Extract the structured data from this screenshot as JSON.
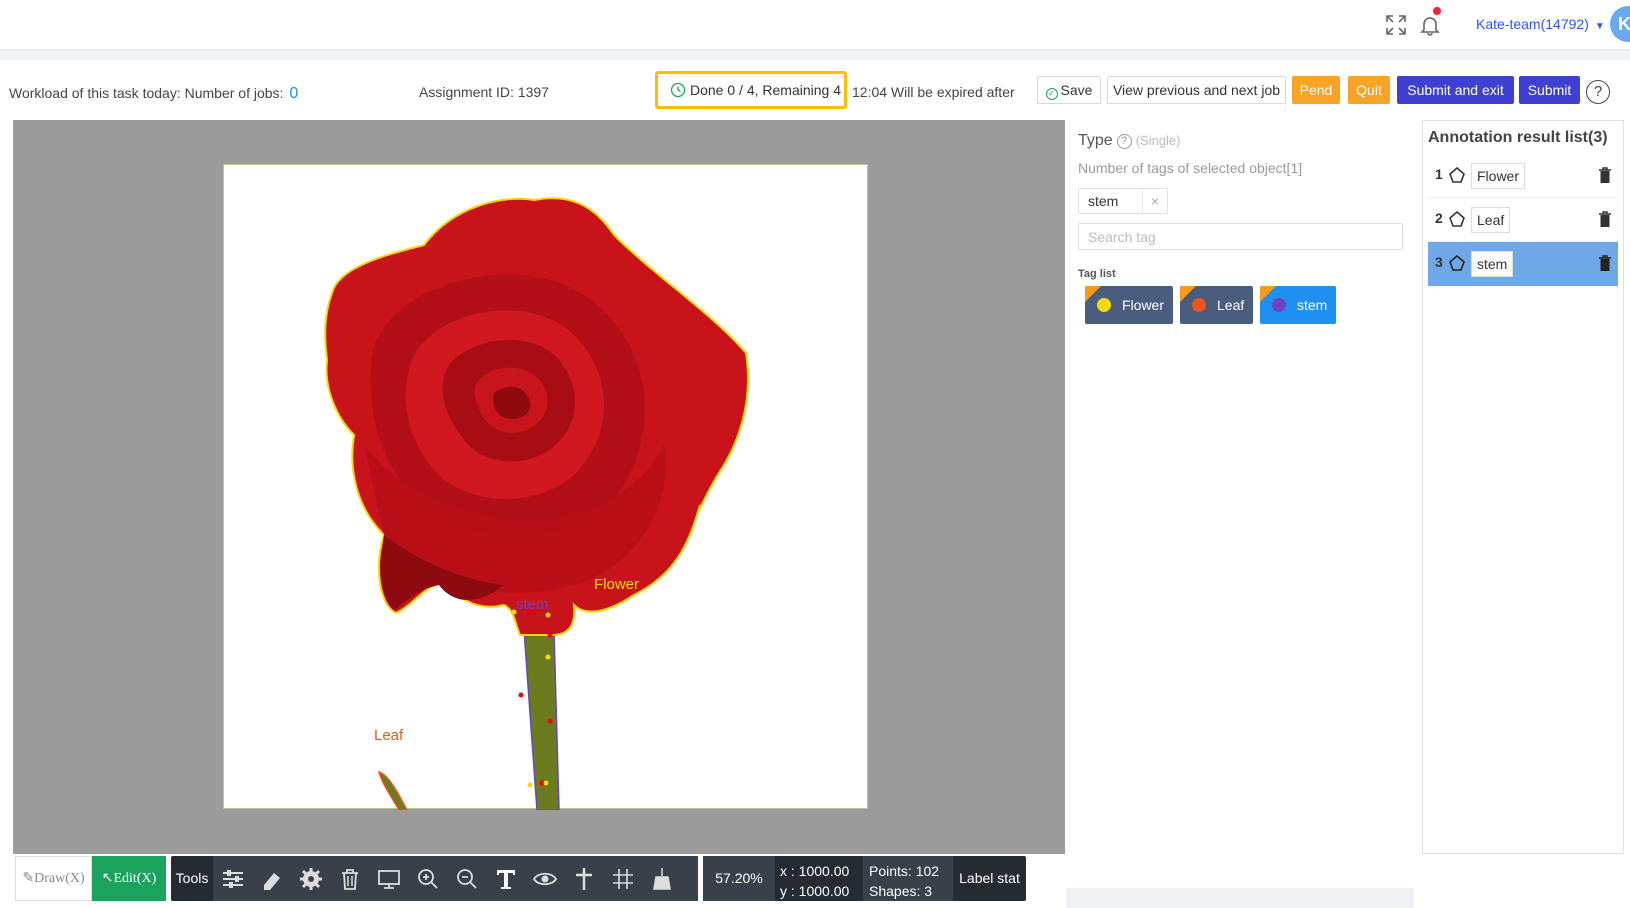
{
  "header": {
    "user": "Kate-team(14792)",
    "avatar_letter": "K"
  },
  "task": {
    "workload_label": "Workload of this task today: Number of jobs:",
    "workload_count": "0",
    "assignment": "Assignment ID: 1397",
    "progress": "Done 0 / 4, Remaining 4",
    "expire": "12:04 Will be expired after",
    "buttons": {
      "save": "Save",
      "view": "View previous and next job",
      "pend": "Pend",
      "quit": "Quit",
      "submit_exit": "Submit and exit",
      "submit": "Submit"
    },
    "help": "?"
  },
  "canvas": {
    "labels": {
      "flower": "Flower",
      "stem": "stem",
      "leaf": "Leaf"
    }
  },
  "toolbar": {
    "draw": "Draw(X)",
    "edit": "Edit(X)",
    "tools": "Tools",
    "zoom": "57.20%",
    "x": "x : 1000.00",
    "y": "y : 1000.00",
    "points": "Points:  102",
    "shapes": "Shapes:  3",
    "label_stat": "Label stat"
  },
  "type_panel": {
    "title": "Type",
    "mode": "(Single)",
    "selected_count": "Number of tags of selected object[1]",
    "selected_tag": "stem",
    "search_placeholder": "Search tag",
    "tag_list_title": "Tag list",
    "tags": [
      {
        "label": "Flower",
        "dot": "#f5d90a",
        "bg": "#4a5d7e"
      },
      {
        "label": "Leaf",
        "dot": "#f0541e",
        "bg": "#4a5d7e"
      },
      {
        "label": "stem",
        "dot": "#6f42c1",
        "bg": "#1f8ff0"
      }
    ]
  },
  "results": {
    "title": "Annotation result list(3)",
    "items": [
      {
        "index": "1",
        "label": "Flower"
      },
      {
        "index": "2",
        "label": "Leaf"
      },
      {
        "index": "3",
        "label": "stem"
      }
    ]
  },
  "colors": {
    "accent_indigo": "#3f3fd1",
    "orange": "#f7a325",
    "green": "#19a35d",
    "flower_outline": "#f5d90a",
    "stem_outline": "#6f42c1",
    "leaf_outline": "#f0541e"
  }
}
